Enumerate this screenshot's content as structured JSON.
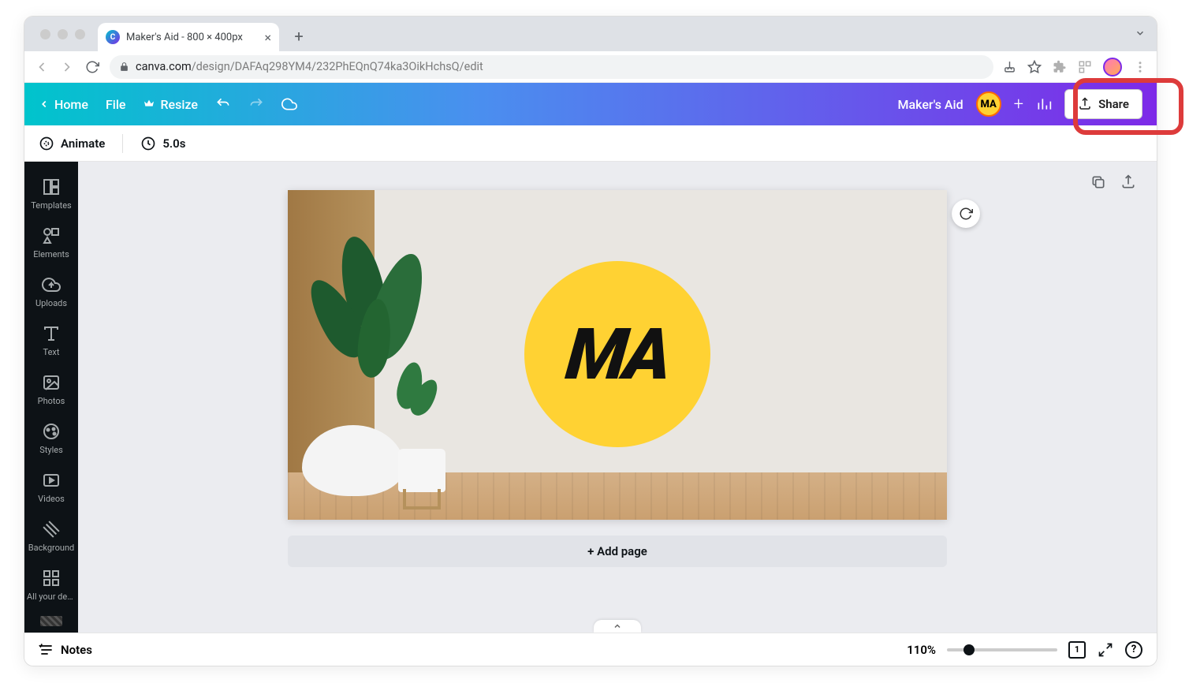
{
  "browser": {
    "tab_title": "Maker's Aid - 800 × 400px",
    "url_host": "canva.com",
    "url_path": "/design/DAFAq298YM4/232PhEQnQ74ka3OikHchsQ/edit"
  },
  "toolbar": {
    "home_label": "Home",
    "file_label": "File",
    "resize_label": "Resize",
    "project_name": "Maker's Aid",
    "user_initials": "MA",
    "share_label": "Share"
  },
  "sub_toolbar": {
    "animate_label": "Animate",
    "duration_label": "5.0s"
  },
  "side_rail": {
    "items": [
      {
        "label": "Templates"
      },
      {
        "label": "Elements"
      },
      {
        "label": "Uploads"
      },
      {
        "label": "Text"
      },
      {
        "label": "Photos"
      },
      {
        "label": "Styles"
      },
      {
        "label": "Videos"
      },
      {
        "label": "Background"
      },
      {
        "label": "All your designs"
      }
    ]
  },
  "canvas": {
    "logo_text": "MA",
    "add_page_label": "+ Add page"
  },
  "footer": {
    "notes_label": "Notes",
    "zoom_label": "110%",
    "page_indicator": "1"
  }
}
